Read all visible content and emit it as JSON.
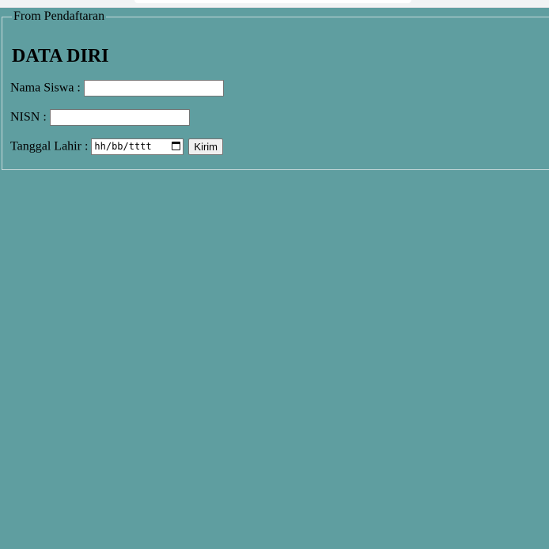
{
  "form": {
    "legend": "From Pendaftaran",
    "title": "DATA DIRI",
    "fields": {
      "nama_label": "Nama Siswa :",
      "nama_value": "",
      "nisn_label": "NISN :",
      "nisn_value": "",
      "tanggal_label": "Tanggal Lahir :",
      "tanggal_placeholder": "hh/bb/tttt"
    },
    "submit_label": "Kirim"
  },
  "icons": {
    "date_picker": "calendar-icon"
  },
  "colors": {
    "page_background": "#5f9ea0"
  }
}
